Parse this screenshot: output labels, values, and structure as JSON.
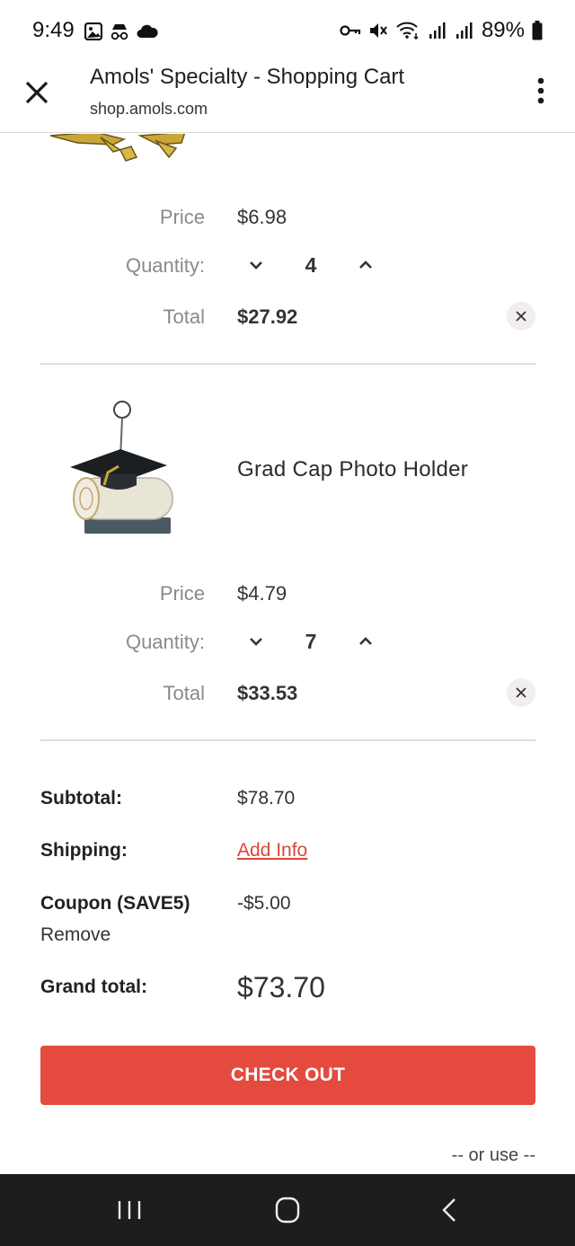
{
  "status_bar": {
    "time": "9:49",
    "battery": "89%",
    "icons_left": [
      "gallery-icon",
      "incognito-icon",
      "cloud-icon"
    ],
    "icons_right": [
      "key-icon",
      "mute-icon",
      "wifi-icon",
      "signal-icon",
      "signal-icon",
      "battery-icon"
    ]
  },
  "browser": {
    "title": "Amols' Specialty - Shopping Cart",
    "url": "shop.amols.com"
  },
  "cart": {
    "items": [
      {
        "name": "",
        "price_label": "Price",
        "price": "$6.98",
        "quantity_label": "Quantity:",
        "quantity": "4",
        "total_label": "Total",
        "total": "$27.92"
      },
      {
        "name": "Grad Cap Photo Holder",
        "price_label": "Price",
        "price": "$4.79",
        "quantity_label": "Quantity:",
        "quantity": "7",
        "total_label": "Total",
        "total": "$33.53"
      }
    ]
  },
  "summary": {
    "subtotal_label": "Subtotal:",
    "subtotal": "$78.70",
    "shipping_label": "Shipping:",
    "shipping_link": "Add Info",
    "coupon_label": "Coupon (SAVE5)",
    "coupon_value": "-$5.00",
    "coupon_remove": "Remove",
    "grand_total_label": "Grand total:",
    "grand_total": "$73.70"
  },
  "checkout": {
    "button_label": "CHECK OUT",
    "or_use": "-- or use --"
  },
  "colors": {
    "accent": "#e44a3e",
    "nav_bar": "#1d1d1f"
  }
}
